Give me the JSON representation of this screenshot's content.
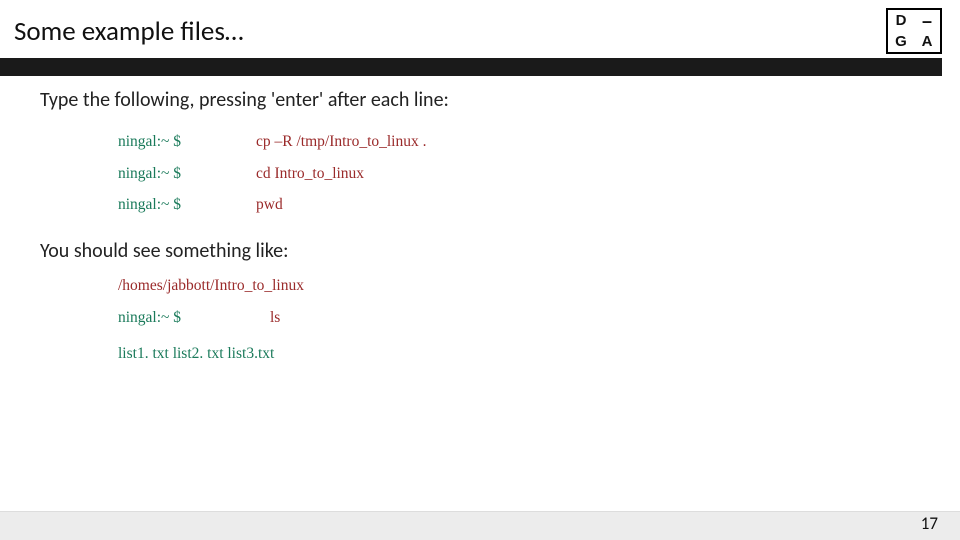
{
  "header": {
    "title": "Some example files…",
    "logo": {
      "tl": "D",
      "tr": "–",
      "bl": "G",
      "br": "A"
    }
  },
  "intro": "Type the following, pressing 'enter' after each line:",
  "commands": [
    {
      "prompt": "ningal:~ $",
      "cmd": "cp –R /tmp/Intro_to_linux ."
    },
    {
      "prompt": "ningal:~ $",
      "cmd": "cd Intro_to_linux"
    },
    {
      "prompt": "ningal:~ $",
      "cmd": "pwd"
    }
  ],
  "result_intro": "You should see something like:",
  "result_path": "/homes/jabbott/Intro_to_linux",
  "ls_row": {
    "prompt": "ningal:~ $",
    "cmd": "ls"
  },
  "files": "list1. txt   list2. txt   list3.txt",
  "page_number": "17"
}
